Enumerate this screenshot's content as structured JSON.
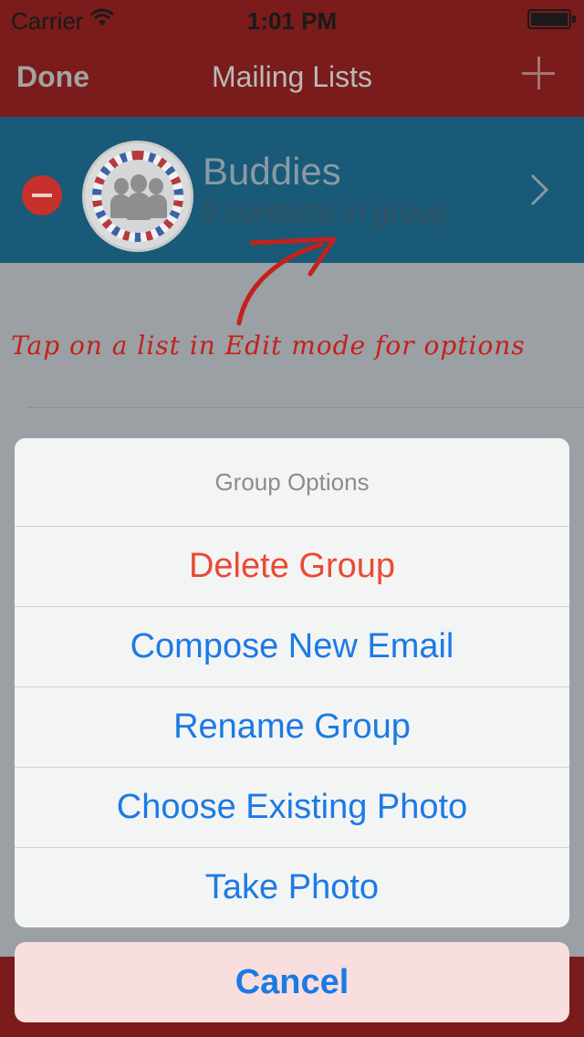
{
  "status": {
    "carrier": "Carrier",
    "time": "1:01 PM"
  },
  "nav": {
    "done": "Done",
    "title": "Mailing Lists"
  },
  "group": {
    "name": "Buddies",
    "subtitle": "0 contacts in group"
  },
  "hint": "Tap on a list in Edit mode for options",
  "sheet": {
    "title": "Group Options",
    "options": [
      {
        "label": "Delete Group"
      },
      {
        "label": "Compose New Email"
      },
      {
        "label": "Rename Group"
      },
      {
        "label": "Choose Existing Photo"
      },
      {
        "label": "Take Photo"
      }
    ],
    "cancel": "Cancel"
  },
  "colors": {
    "nav_bar": "#7a1c1b",
    "group_row": "#185a78",
    "destructive": "#ea4a33",
    "action_blue": "#1c7ae4"
  }
}
